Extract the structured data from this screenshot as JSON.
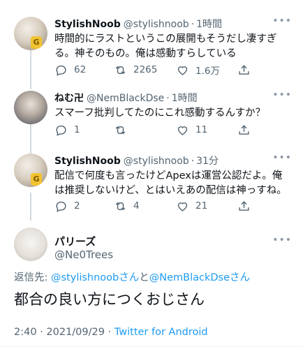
{
  "colors": {
    "accent": "#1d9bf0",
    "muted": "#536471",
    "text": "#0f1419"
  },
  "tweets": [
    {
      "display_name": "StylishNoob",
      "handle": "@stylishnoob",
      "time": "1時間",
      "text": "時間的にラストというこの展開もそうだし凄すぎる。神そのもの。俺は感動すらしている",
      "reply_count": "62",
      "retweet_count": "2265",
      "like_count": "1.6万"
    },
    {
      "display_name": "ねむ卍",
      "handle": "@NemBlackDse",
      "time": "1時間",
      "text": "スマーフ批判してたのにこれ感動するんすか？",
      "reply_count": "1",
      "retweet_count": "",
      "like_count": "11"
    },
    {
      "display_name": "StylishNoob",
      "handle": "@stylishnoob",
      "time": "31分",
      "text": "配信で何度も言ったけどApexは運営公認だよ。俺は推奨しないけど、とはいえあの配信は神っすね。",
      "reply_count": "2",
      "retweet_count": "4",
      "like_count": "21"
    }
  ],
  "main_tweet": {
    "display_name": "パリーズ",
    "handle": "@Ne0Trees",
    "reply_to_prefix": "返信先: ",
    "reply_to_user1": "@stylishnoobさん",
    "reply_to_and": "と",
    "reply_to_user2": "@NemBlackDseさん",
    "text": "都合の良い方につくおじさん",
    "time": "2:40",
    "separator": " · ",
    "date": "2021/09/29",
    "separator2": " · ",
    "app": "Twitter for Android"
  },
  "icons": {
    "more": "more-icon",
    "reply": "reply-icon",
    "retweet": "retweet-icon",
    "like": "heart-icon",
    "share": "share-icon"
  }
}
